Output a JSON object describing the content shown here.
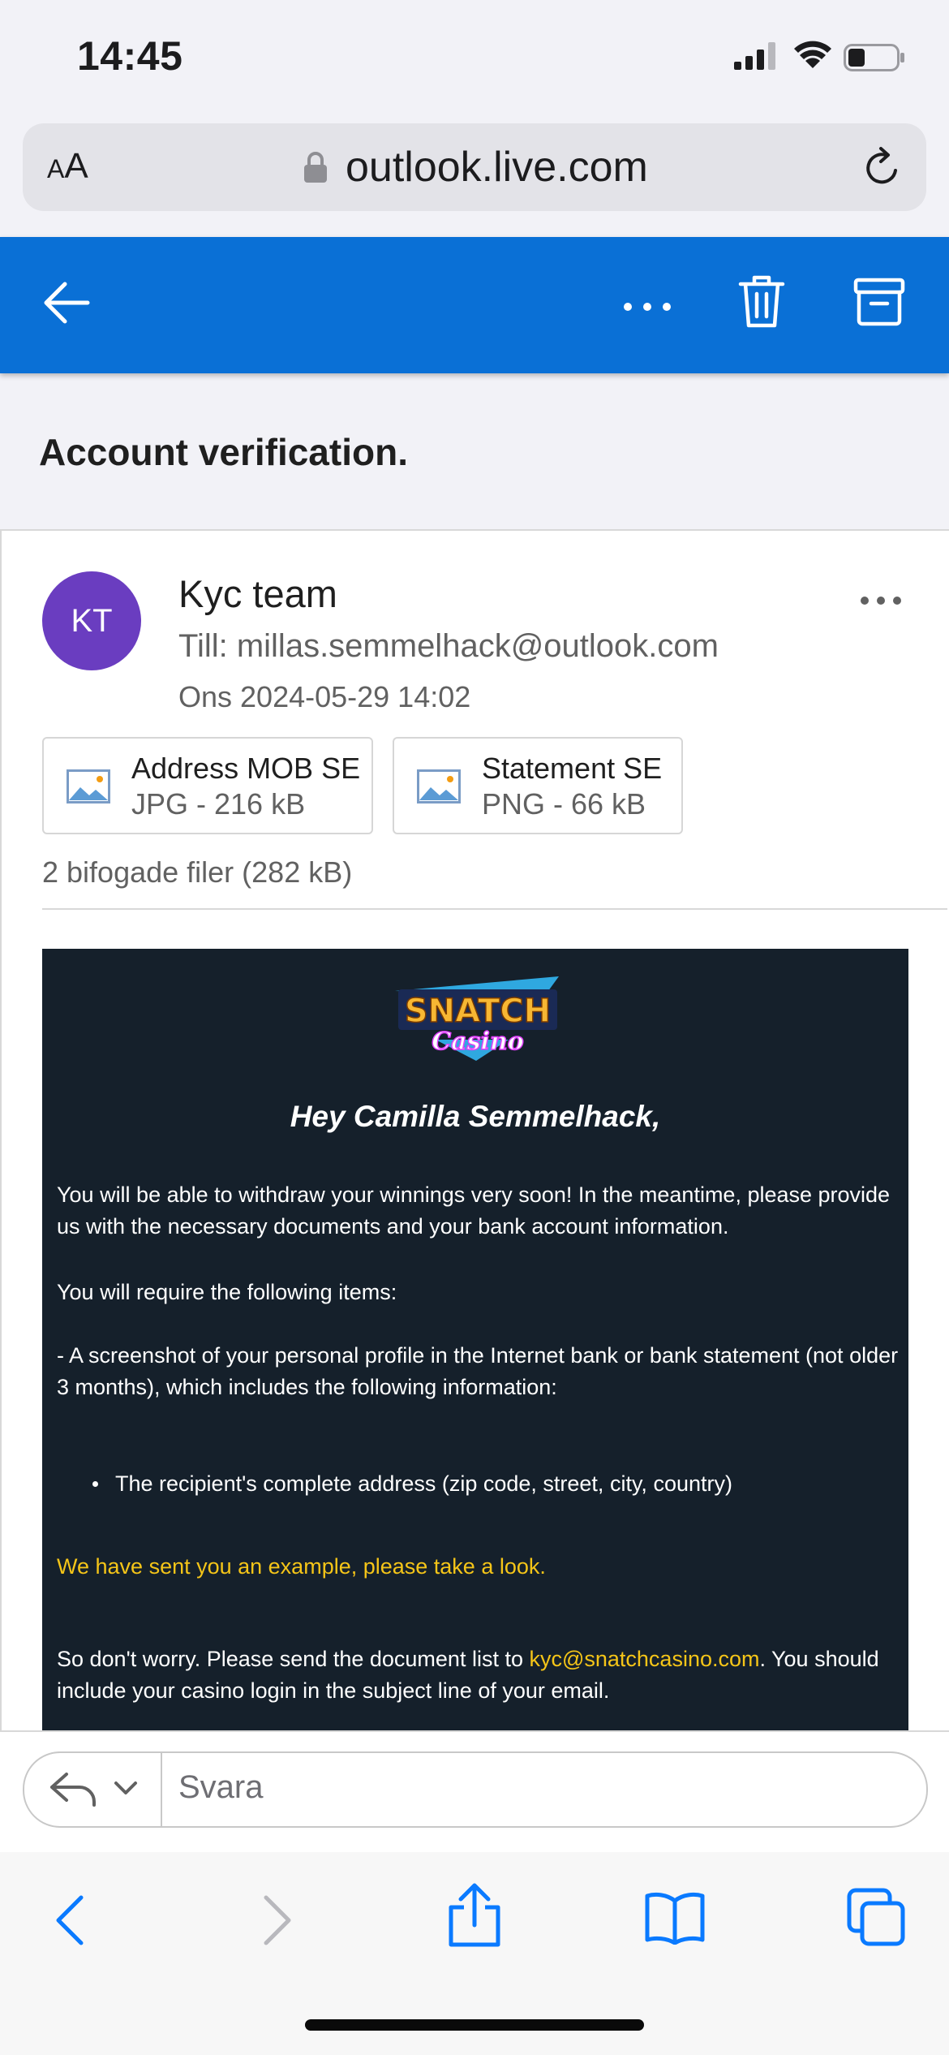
{
  "status_bar": {
    "time": "14:45"
  },
  "browser": {
    "text_size_label_small": "A",
    "text_size_label_large": "A",
    "url": "outlook.live.com"
  },
  "email": {
    "subject": "Account verification.",
    "avatar_initials": "KT",
    "avatar_color": "#6a3dc0",
    "sender": "Kyc team",
    "recipient": "Till: millas.semmelhack@outlook.com",
    "date": "Ons 2024-05-29 14:02",
    "attachments": [
      {
        "name": "Address MOB SE",
        "meta": "JPG - 216 kB"
      },
      {
        "name": "Statement SE",
        "meta": "PNG - 66 kB"
      }
    ],
    "attachments_summary": "2 bifogade filer (282 kB)"
  },
  "body": {
    "logo_text_top": "SNATCH",
    "logo_text_bottom": "Casino",
    "greeting": "Hey Camilla Semmelhack,",
    "paragraph_1": "You will be able to withdraw your winnings very soon! In the meantime, please provide us with the necessary documents and your bank account information.",
    "paragraph_2": "You will require the following items:",
    "paragraph_3": "- A screenshot of your personal profile in the Internet bank or bank statement (not older 3 months), which includes the following information:",
    "bullet_1": "The recipient's complete address (zip code, street, city, country)",
    "example_note": "We have sent you an example, please take a look.",
    "paragraph_5_before": "So don't worry. Please send the document list to ",
    "paragraph_5_email": "kyc@snatchcasino.com",
    "paragraph_5_after": ". You should include your casino login in the subject line of your email."
  },
  "reply": {
    "placeholder": "Svara"
  },
  "colors": {
    "outlook_blue": "#0a70d6",
    "email_background": "#15202b",
    "highlight_yellow": "#f5c518",
    "safari_blue": "#0a7aff"
  },
  "icons": [
    "back-arrow-icon",
    "more-icon",
    "trash-icon",
    "archive-icon",
    "lock-icon",
    "reload-icon",
    "image-icon",
    "reply-icon",
    "chevron-down-icon",
    "share-icon",
    "bookmarks-icon",
    "tabs-icon"
  ]
}
